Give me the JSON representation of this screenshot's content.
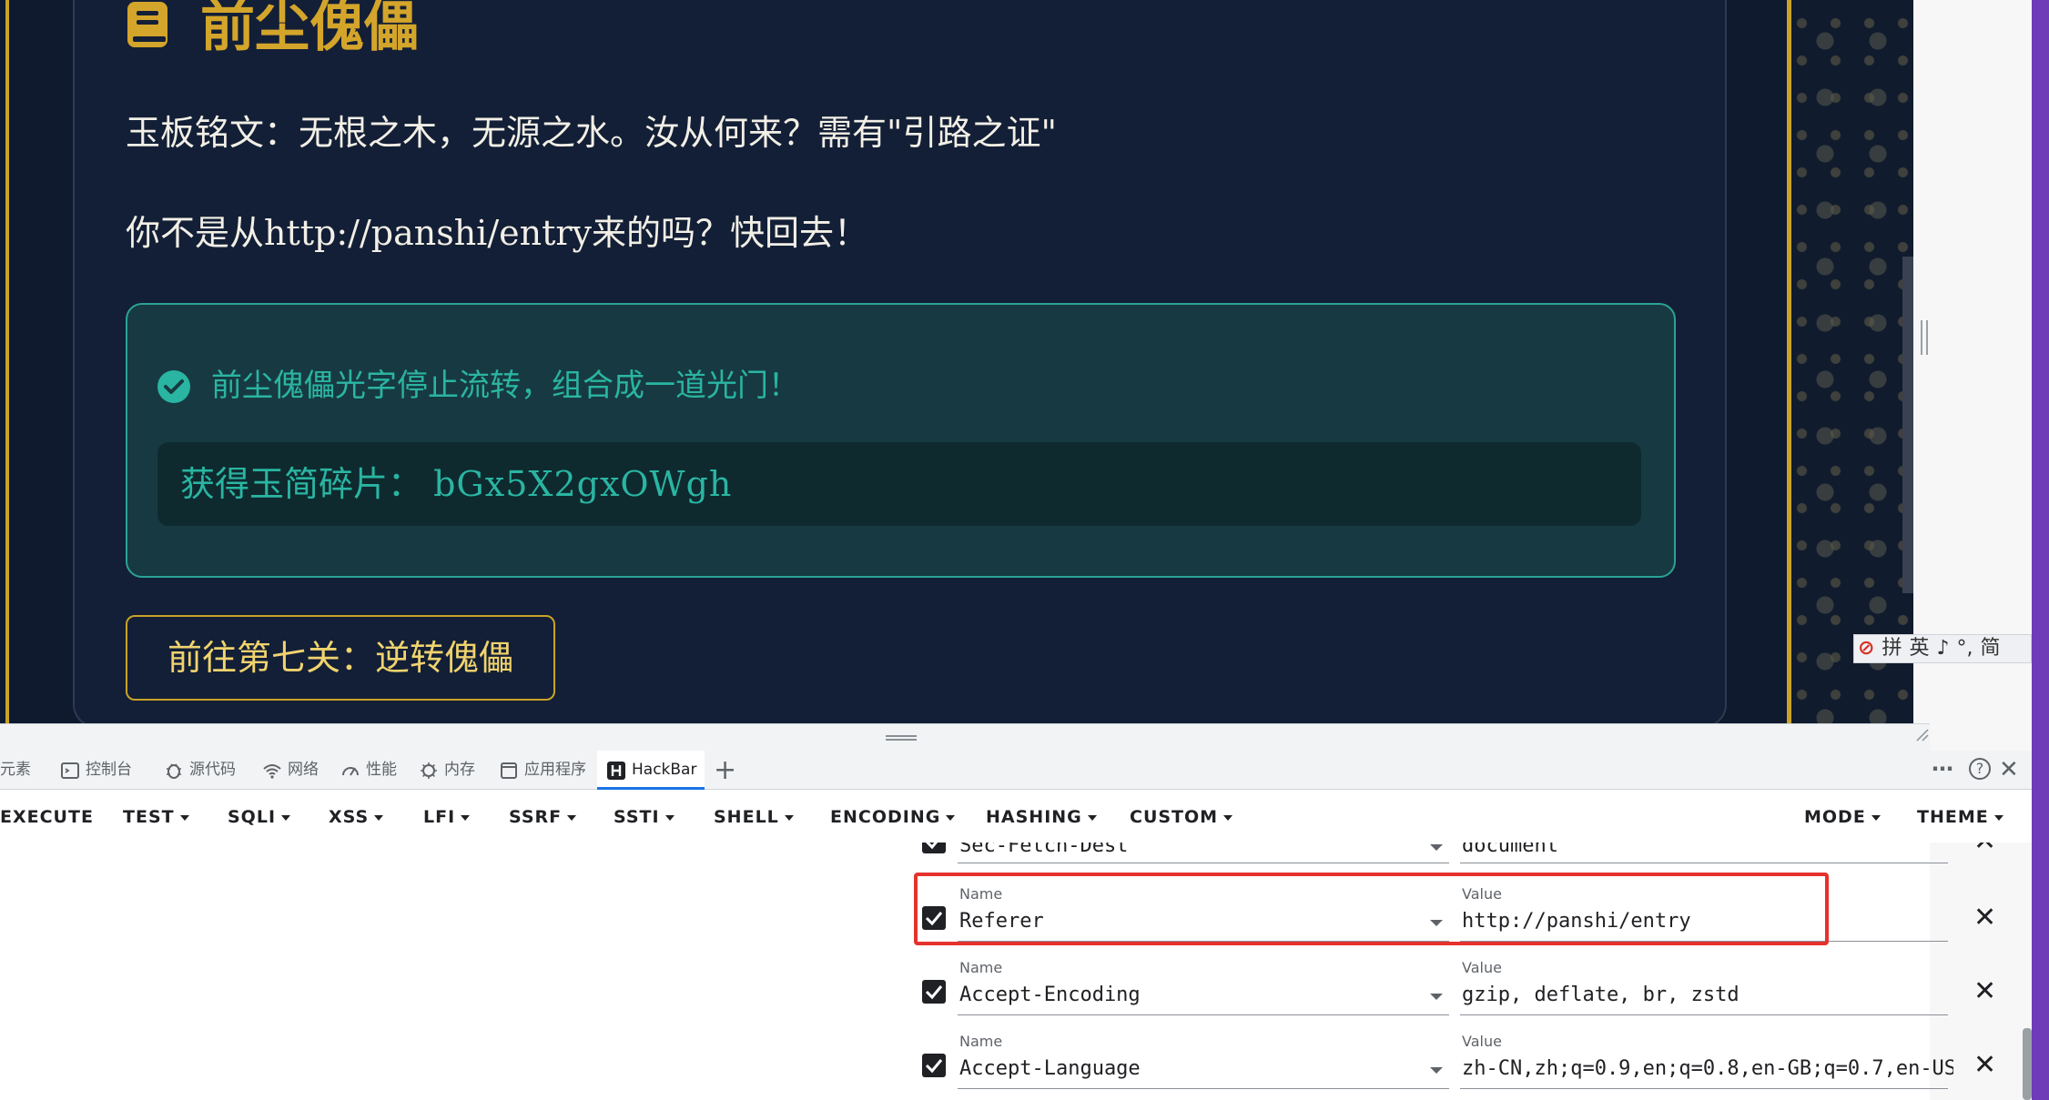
{
  "page": {
    "title": "前尘傀儡",
    "story_line_1": "玉板铭文：无根之木，无源之水。汝从何来？需有\"引路之证\"",
    "story_line_2": "你不是从http://panshi/entry来的吗？快回去！",
    "success_message": "前尘傀儡光字停止流转，组合成一道光门！",
    "fragment_label": "获得玉简碎片：",
    "fragment_code": "bGx5X2gxOWgh",
    "next_button": "前往第七关：逆转傀儡",
    "colors": {
      "gold": "#c9a227",
      "teal": "#2ab5a2",
      "background": "#0f1a2e"
    }
  },
  "ime_toolbar": {
    "items": [
      "拼",
      "英",
      "♪",
      "°,",
      "简"
    ]
  },
  "devtools": {
    "tabs": [
      {
        "label": "元素",
        "icon": "elements-icon"
      },
      {
        "label": "控制台",
        "icon": "console-icon"
      },
      {
        "label": "源代码",
        "icon": "bug-icon"
      },
      {
        "label": "网络",
        "icon": "wifi-icon"
      },
      {
        "label": "性能",
        "icon": "gauge-icon"
      },
      {
        "label": "内存",
        "icon": "chip-icon"
      },
      {
        "label": "应用程序",
        "icon": "app-icon"
      },
      {
        "label": "HackBar",
        "icon": "hackbar-icon",
        "active": true
      }
    ],
    "add_tab": "+",
    "more": "⋯",
    "help": "?",
    "close": "✕"
  },
  "hackbar": {
    "menu": [
      "EXECUTE",
      "TEST",
      "SQLI",
      "XSS",
      "LFI",
      "SSRF",
      "SSTI",
      "SHELL",
      "ENCODING",
      "HASHING",
      "CUSTOM"
    ],
    "menu_right": [
      "MODE",
      "THEME"
    ],
    "headers": [
      {
        "name": "Sec-Fetch-Dest",
        "value": "document",
        "checked": true,
        "partial": true
      },
      {
        "name_label": "Name",
        "name": "Referer",
        "value_label": "Value",
        "value": "http://panshi/entry",
        "checked": true,
        "highlighted": true
      },
      {
        "name_label": "Name",
        "name": "Accept-Encoding",
        "value_label": "Value",
        "value": "gzip, deflate, br, zstd",
        "checked": true
      },
      {
        "name_label": "Name",
        "name": "Accept-Language",
        "value_label": "Value",
        "value": "zh-CN,zh;q=0.9,en;q=0.8,en-GB;q=0.7,en-US",
        "checked": true
      }
    ],
    "remove_symbol": "✕"
  }
}
